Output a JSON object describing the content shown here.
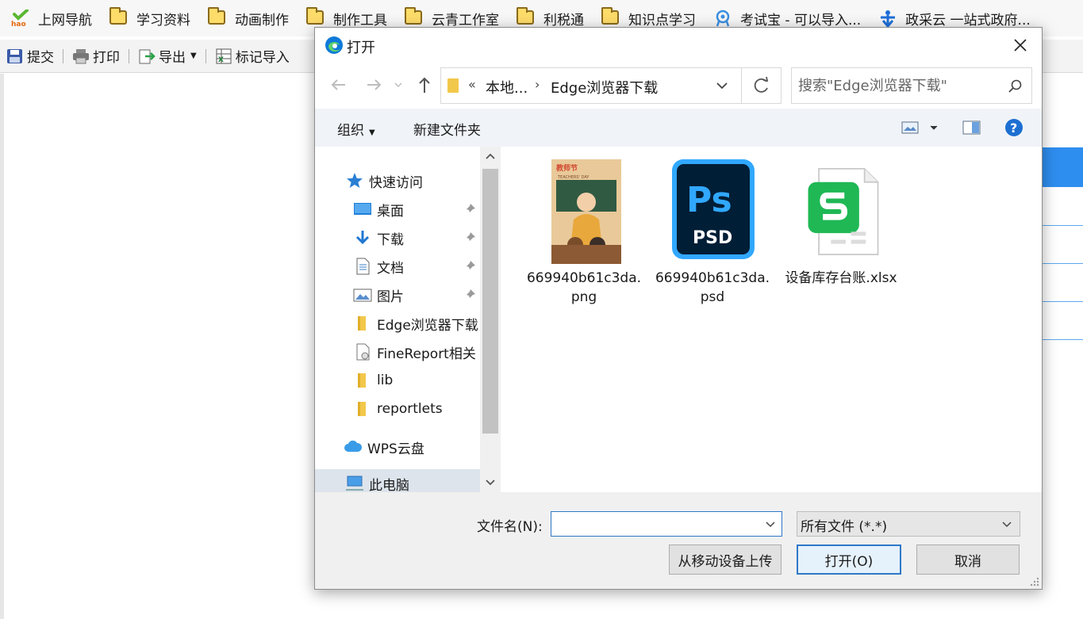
{
  "bookmarks": [
    {
      "label": "上网导航",
      "icon": "hao-logo-icon"
    },
    {
      "label": "学习资料",
      "icon": "folder-icon"
    },
    {
      "label": "动画制作",
      "icon": "folder-icon"
    },
    {
      "label": "制作工具",
      "icon": "folder-icon"
    },
    {
      "label": "云青工作室",
      "icon": "folder-icon"
    },
    {
      "label": "利税通",
      "icon": "folder-icon"
    },
    {
      "label": "知识点学习",
      "icon": "folder-icon"
    },
    {
      "label": "考试宝 - 可以导入...",
      "icon": "kaoshibao-icon"
    },
    {
      "label": "政采云 一站式政府...",
      "icon": "zhengcaiyun-icon"
    }
  ],
  "hao_logo_text": "hao",
  "toolbar": {
    "submit": "提交",
    "print": "打印",
    "export": "导出",
    "import_marked": "标记导入"
  },
  "dialog": {
    "title": "打开",
    "address": {
      "prefix": "«",
      "crumb1": "本地...",
      "arrow": "›",
      "crumb2": "Edge浏览器下载"
    },
    "search_placeholder": "搜索\"Edge浏览器下载\"",
    "commands": {
      "organize": "组织",
      "new_folder": "新建文件夹"
    },
    "nav": {
      "quick_access": "快速访问",
      "items": [
        {
          "label": "桌面",
          "icon": "desktop-icon",
          "pinned": true
        },
        {
          "label": "下载",
          "icon": "download-icon",
          "pinned": true
        },
        {
          "label": "文档",
          "icon": "document-icon",
          "pinned": true
        },
        {
          "label": "图片",
          "icon": "pictures-icon",
          "pinned": true
        },
        {
          "label": "Edge浏览器下载",
          "icon": "folder-icon",
          "pinned": false
        },
        {
          "label": "FineReport相关",
          "icon": "shortcut-file-icon",
          "pinned": false
        },
        {
          "label": "lib",
          "icon": "folder-icon",
          "pinned": false
        },
        {
          "label": "reportlets",
          "icon": "folder-icon",
          "pinned": false
        }
      ],
      "wps_cloud": "WPS云盘",
      "this_pc": "此电脑"
    },
    "files": [
      {
        "name": "669940b61c3da.png",
        "icon": "image-thumbnail-icon",
        "thumb_text": "教师节",
        "thumb_sub": "TEACHERS' DAY"
      },
      {
        "name": "669940b61c3da.psd",
        "icon": "photoshop-icon",
        "ps_text": "Ps",
        "psd_text": "PSD"
      },
      {
        "name": "设备库存台账.xlsx",
        "icon": "wps-spreadsheet-icon"
      }
    ],
    "footer": {
      "filename_label": "文件名(N):",
      "filename_value": "",
      "filetype": "所有文件 (*.*)",
      "upload_btn": "从移动设备上传",
      "open_btn": "打开(O)",
      "cancel_btn": "取消"
    },
    "colors": {
      "accent": "#2f78c7",
      "cmdbar_bg": "#f0f4f9",
      "ps_blue": "#31a8ff",
      "ps_dark": "#001e36",
      "wps_green": "#1fb855",
      "help_blue": "#1c6fd1"
    }
  }
}
